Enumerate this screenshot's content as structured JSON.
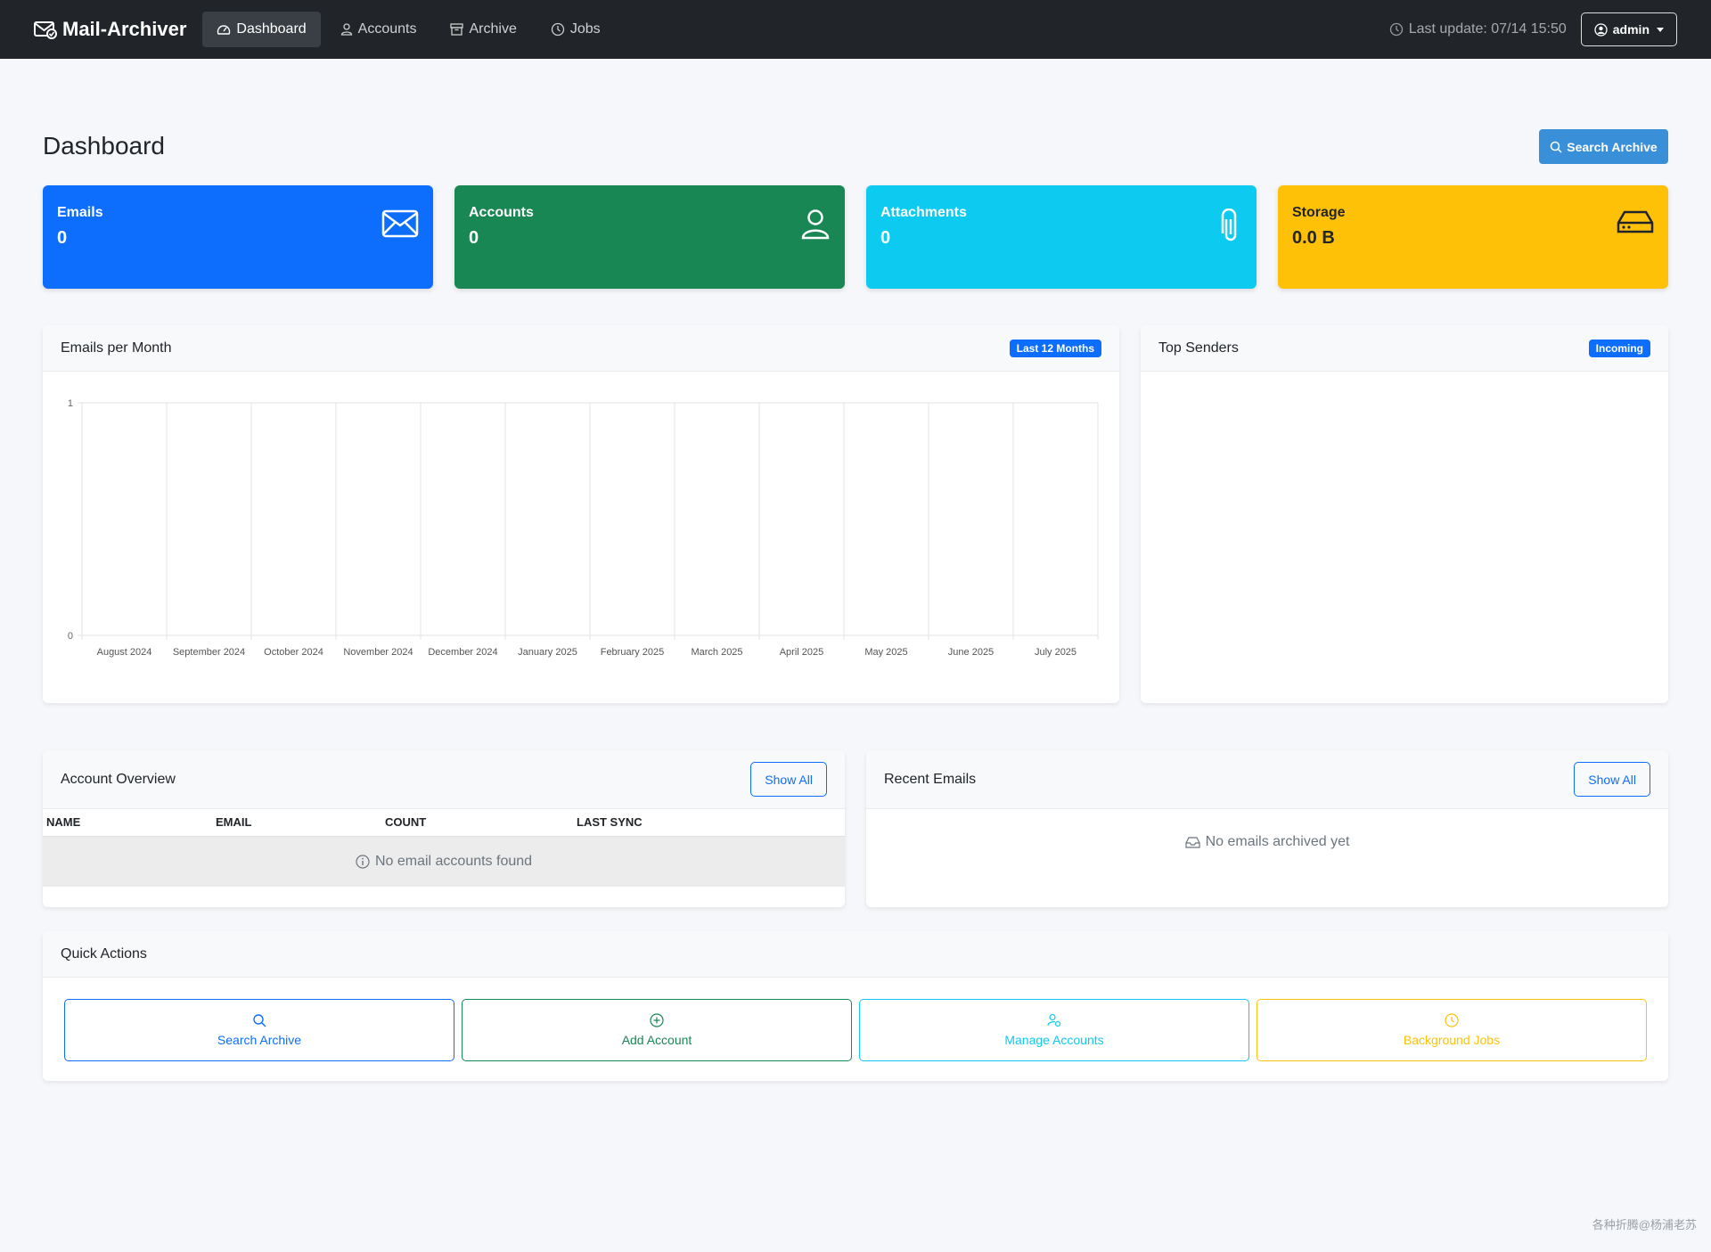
{
  "navbar": {
    "brand": "Mail-Archiver",
    "links": [
      {
        "label": "Dashboard",
        "icon": "speedometer-icon",
        "active": true
      },
      {
        "label": "Accounts",
        "icon": "person-icon",
        "active": false
      },
      {
        "label": "Archive",
        "icon": "archive-icon",
        "active": false
      },
      {
        "label": "Jobs",
        "icon": "clock-icon",
        "active": false
      }
    ],
    "last_update": "Last update: 07/14 15:50",
    "user": "admin"
  },
  "page": {
    "title": "Dashboard",
    "search_button": "Search Archive"
  },
  "stats": [
    {
      "label": "Emails",
      "value": "0",
      "icon": "envelope-icon",
      "color": "#0d6efd"
    },
    {
      "label": "Accounts",
      "value": "0",
      "icon": "person-icon",
      "color": "#198754"
    },
    {
      "label": "Attachments",
      "value": "0",
      "icon": "paperclip-icon",
      "color": "#0dcaf0"
    },
    {
      "label": "Storage",
      "value": "0.0 B",
      "icon": "hdd-icon",
      "color": "#ffc107"
    }
  ],
  "emails_per_month": {
    "title": "Emails per Month",
    "badge": "Last 12 Months"
  },
  "chart_data": {
    "type": "bar",
    "categories": [
      "August 2024",
      "September 2024",
      "October 2024",
      "November 2024",
      "December 2024",
      "January 2025",
      "February 2025",
      "March 2025",
      "April 2025",
      "May 2025",
      "June 2025",
      "July 2025"
    ],
    "values": [
      0,
      0,
      0,
      0,
      0,
      0,
      0,
      0,
      0,
      0,
      0,
      0
    ],
    "ylim": [
      0,
      1
    ],
    "yticks": [
      "0",
      "1"
    ],
    "grid": true
  },
  "top_senders": {
    "title": "Top Senders",
    "badge": "Incoming"
  },
  "account_overview": {
    "title": "Account Overview",
    "show_all": "Show All",
    "columns": [
      "NAME",
      "EMAIL",
      "COUNT",
      "LAST SYNC"
    ],
    "empty": "No email accounts found"
  },
  "recent_emails": {
    "title": "Recent Emails",
    "show_all": "Show All",
    "empty": "No emails archived yet"
  },
  "quick_actions": {
    "title": "Quick Actions",
    "buttons": [
      {
        "label": "Search Archive",
        "icon": "search-icon",
        "color": "#0d6efd"
      },
      {
        "label": "Add Account",
        "icon": "plus-circle-icon",
        "color": "#198754"
      },
      {
        "label": "Manage Accounts",
        "icon": "person-gear-icon",
        "color": "#0dcaf0"
      },
      {
        "label": "Background Jobs",
        "icon": "clock-icon",
        "color": "#ffc107"
      }
    ]
  },
  "watermark": "各种折腾@杨浦老苏"
}
